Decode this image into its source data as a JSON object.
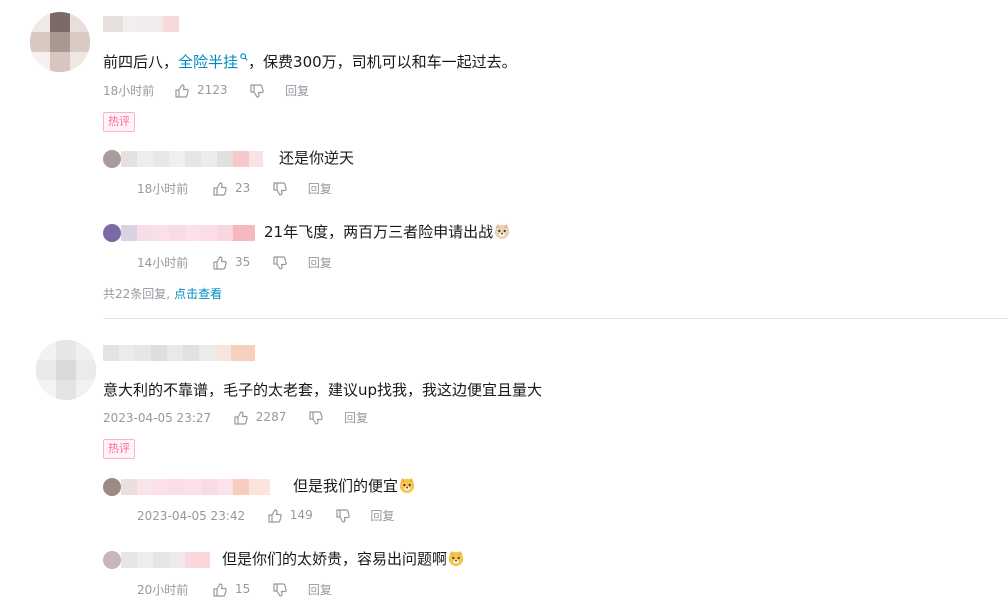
{
  "comments": [
    {
      "content_parts": [
        "前四后八，",
        "全险半挂",
        "，保费300万，司机可以和车一起过去。"
      ],
      "time": "18小时前",
      "likes": "2123",
      "reply_label": "回复",
      "hot_badge": "热评",
      "replies": [
        {
          "content": "还是你逆天",
          "time": "18小时前",
          "likes": "23",
          "reply_label": "回复"
        },
        {
          "content": "21年飞度，两百万三者险申请出战",
          "time": "14小时前",
          "likes": "35",
          "reply_label": "回复"
        }
      ],
      "more": {
        "count_text": "共22条回复,",
        "link_text": "点击查看"
      }
    },
    {
      "content": "意大利的不靠谱，毛子的太老套，建议up找我，我这边便宜且量大",
      "time": "2023-04-05 23:27",
      "likes": "2287",
      "reply_label": "回复",
      "hot_badge": "热评",
      "replies": [
        {
          "content": "但是我们的便宜",
          "time": "2023-04-05 23:42",
          "likes": "149",
          "reply_label": "回复"
        },
        {
          "content": "但是你们的太娇贵，容易出问题啊",
          "time": "20小时前",
          "likes": "15",
          "reply_label": "回复"
        }
      ]
    }
  ],
  "icons": {
    "like": "thumbs-up-icon",
    "dislike": "thumbs-down-icon",
    "search_suffix": "search-icon",
    "emoji": "doge-emoji-icon"
  },
  "colors": {
    "link": "#008ac5",
    "meta": "#9499a0",
    "hot_border": "#ffb3c7",
    "hot_text": "#ff6699"
  }
}
